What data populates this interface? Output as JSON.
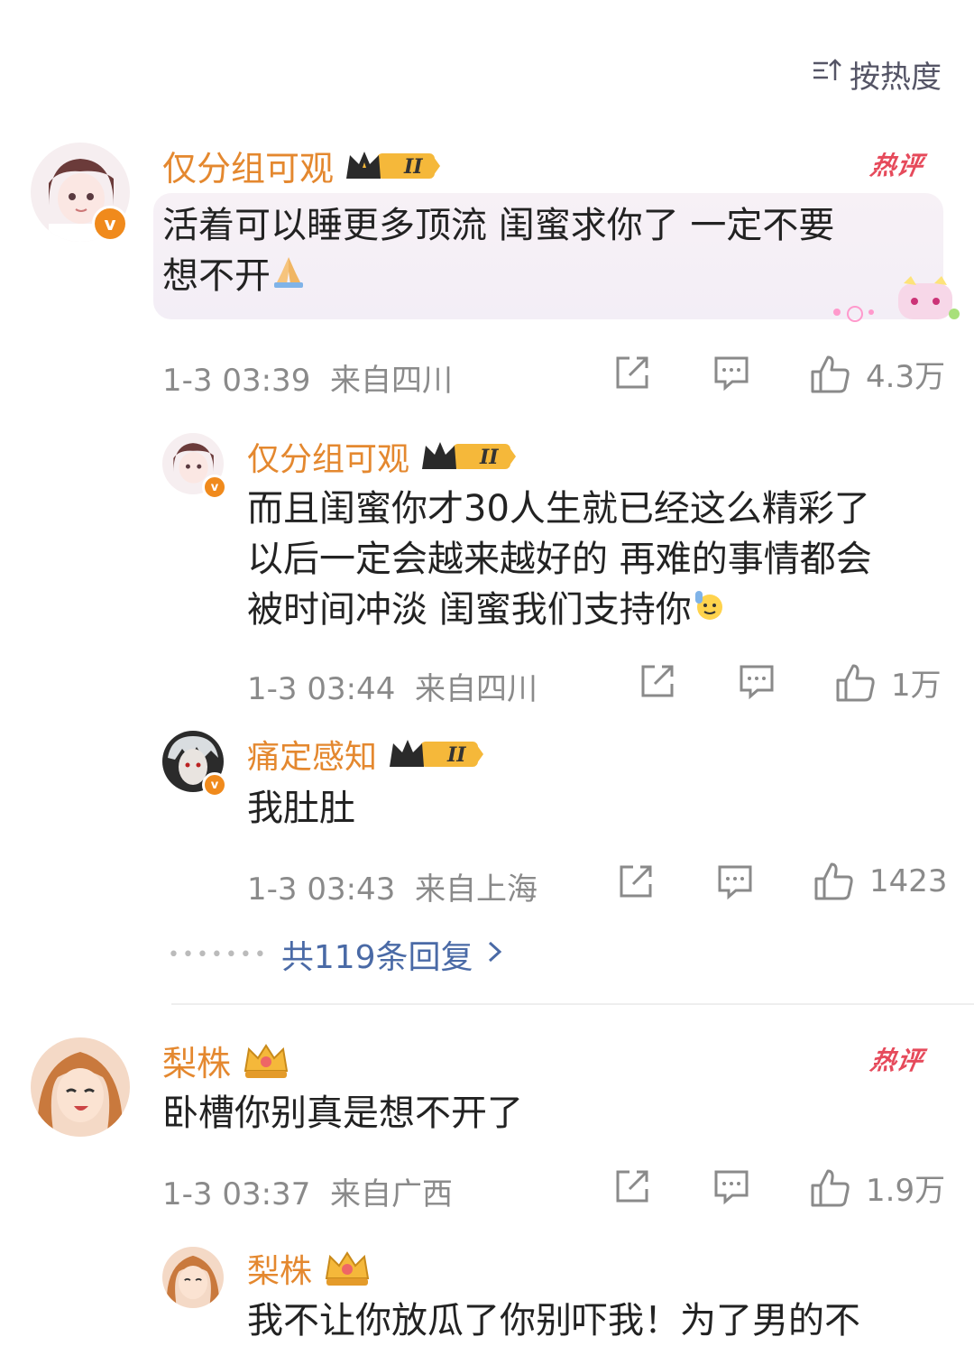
{
  "sort": {
    "label": "按热度"
  },
  "hot_label": "热评",
  "comments": [
    {
      "user": "仅分组可观",
      "level": "II",
      "text_line1": "活着可以睡更多顶流 闺蜜求你了 一定不要",
      "text_line2": "想不开",
      "time": "1-3 03:39",
      "location": "来自四川",
      "likes": "4.3万"
    },
    {
      "user": "仅分组可观",
      "level": "II",
      "text_line1": "而且闺蜜你才30人生就已经这么精彩了",
      "text_line2": "以后一定会越来越好的 再难的事情都会",
      "text_line3": "被时间冲淡 闺蜜我们支持你",
      "time": "1-3 03:44",
      "location": "来自四川",
      "likes": "1万"
    },
    {
      "user": "痛定感知",
      "level": "II",
      "text": "我肚肚",
      "time": "1-3 03:43",
      "location": "来自上海",
      "likes": "1423"
    },
    {
      "user": "梨株",
      "text": "卧槽你别真是想不开了",
      "time": "1-3 03:37",
      "location": "来自广西",
      "likes": "1.9万"
    },
    {
      "user": "梨株",
      "text": "我不让你放瓜了你别吓我！为了男的不"
    }
  ],
  "replies_more": "共119条回复",
  "colors": {
    "username": "#e4882f",
    "hot": "#e64a5b",
    "link": "#4a6aa6",
    "meta": "#8a8a8a"
  }
}
